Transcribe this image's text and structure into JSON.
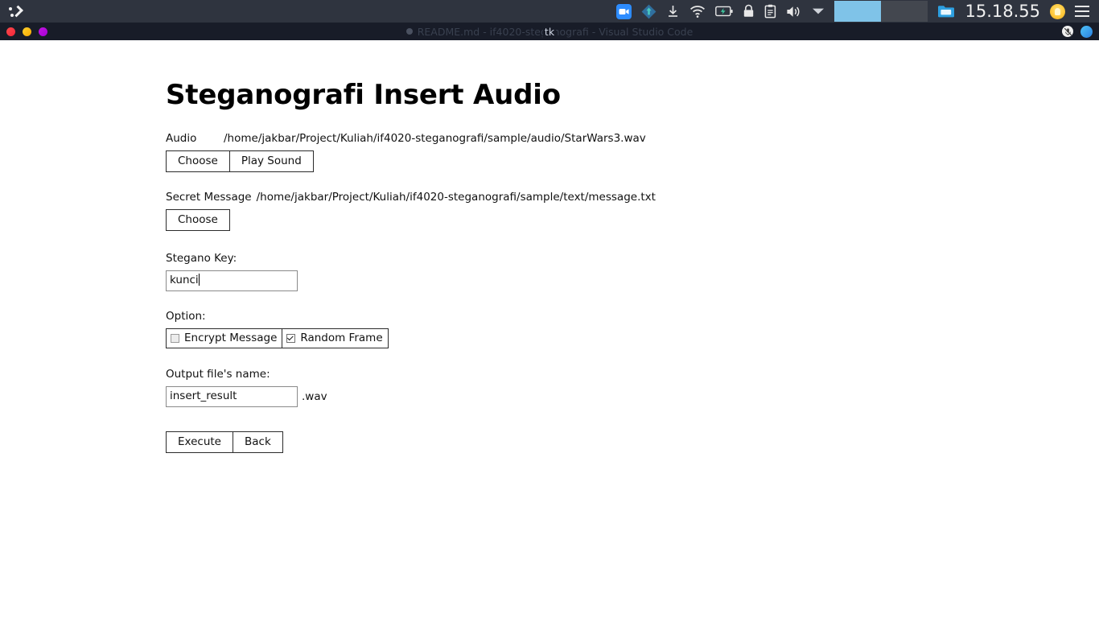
{
  "topbar": {
    "logo_name": "terminal-prompt-logo",
    "tray_icons": [
      {
        "name": "zoom-video-icon",
        "label": "Zoom"
      },
      {
        "name": "software-updater-icon",
        "label": "Software Updater"
      },
      {
        "name": "download-icon",
        "label": "Downloads"
      },
      {
        "name": "wifi-icon",
        "label": "Wi-Fi"
      },
      {
        "name": "battery-charging-icon",
        "label": "Battery"
      },
      {
        "name": "lock-icon",
        "label": "Lock"
      },
      {
        "name": "clipboard-icon",
        "label": "Clipboard"
      },
      {
        "name": "volume-icon",
        "label": "Volume"
      },
      {
        "name": "chevron-down-icon",
        "label": "System menu"
      }
    ],
    "workspaces": [
      {
        "name": "workspace-1",
        "active": true
      },
      {
        "name": "workspace-2",
        "active": false
      }
    ],
    "folder_icon": "folder-icon",
    "clock": "15.18.55",
    "bulb_icon": "lightbulb-icon",
    "menu_icon": "hamburger-menu-icon"
  },
  "titlebar": {
    "background_title": "README.md - if4020-steganografi - Visual Studio Code",
    "active_title": "tk",
    "window_controls": [
      {
        "name": "close-button",
        "color": "#ff4b4b"
      },
      {
        "name": "minimize-button",
        "color": "#ffd12e"
      },
      {
        "name": "maximize-button",
        "color": "#c215e0"
      }
    ],
    "right_icons": [
      {
        "name": "microphone-muted-icon"
      },
      {
        "name": "status-indicator-dot"
      }
    ]
  },
  "app": {
    "page_title": "Steganografi Insert Audio",
    "audio": {
      "label": "Audio",
      "path": "/home/jakbar/Project/Kuliah/if4020-steganografi/sample/audio/StarWars3.wav",
      "choose_label": "Choose",
      "play_label": "Play Sound"
    },
    "secret_message": {
      "label": "Secret Message",
      "path": "/home/jakbar/Project/Kuliah/if4020-steganografi/sample/text/message.txt",
      "choose_label": "Choose"
    },
    "stegano_key": {
      "label": "Stegano Key:",
      "value": "kunci",
      "placeholder": ""
    },
    "option": {
      "label": "Option:",
      "items": [
        {
          "name": "encrypt-message",
          "label": "Encrypt Message",
          "checked": false
        },
        {
          "name": "random-frame",
          "label": "Random Frame",
          "checked": true
        }
      ]
    },
    "output": {
      "label": "Output file's name:",
      "value": "insert_result",
      "placeholder": "",
      "extension": ".wav"
    },
    "actions": {
      "execute_label": "Execute",
      "back_label": "Back"
    }
  },
  "colors": {
    "topbar_bg": "#2f343f",
    "titlebar_bg": "#181c28",
    "workspace_active": "#7fc3e8",
    "app_bg": "#ffffff",
    "text": "#111111"
  }
}
